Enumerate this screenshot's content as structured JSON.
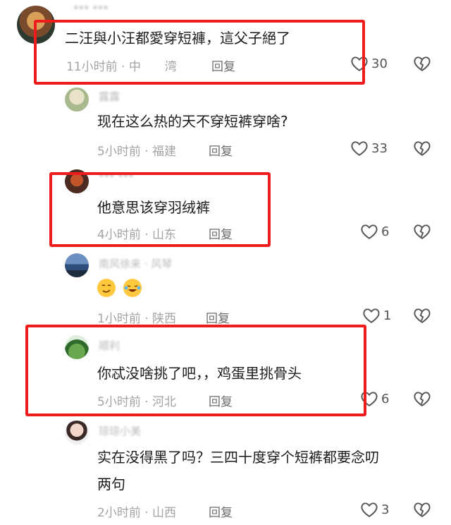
{
  "comments": [
    {
      "username": "*** ***",
      "text": "二汪與小汪都愛穿短褲，這父子絕了",
      "time_location": "11小时前 · 中　　湾",
      "reply_label": "回复",
      "likes": "30"
    },
    {
      "username": "露露",
      "text": "现在这么热的天不穿短裤穿啥?",
      "time_location": "5小时前 · 福建",
      "reply_label": "回复",
      "likes": "33"
    },
    {
      "username": "*** ***",
      "text": "他意思该穿羽绒裤",
      "time_location": "4小时前 · 山东",
      "reply_label": "回复",
      "likes": "6"
    },
    {
      "username": "南风徐来 · 风琴",
      "text": "",
      "emojis": [
        "smirk-face",
        "laughing-crying-face"
      ],
      "time_location": "1小时前 · 陕西",
      "reply_label": "回复",
      "likes": "1"
    },
    {
      "username": "顺利",
      "text": "你忒没啥挑了吧，，鸡蛋里挑骨头",
      "time_location": "5小时前 · 河北",
      "reply_label": "回复",
      "likes": "6"
    },
    {
      "username": "琼琼小美",
      "text_line1": "实在没得黑了吗？三四十度穿个短裤都要念叨",
      "text_line2": "两句",
      "time_location": "2小时前 · 山西",
      "reply_label": "回复",
      "likes": "3"
    }
  ],
  "colors": {
    "highlight_box": "#ee1c1c",
    "meta_text": "#a3a3a3",
    "body_text": "#1b1b1b"
  },
  "icons": {
    "like": "heart-outline-icon",
    "dislike": "broken-heart-icon"
  }
}
